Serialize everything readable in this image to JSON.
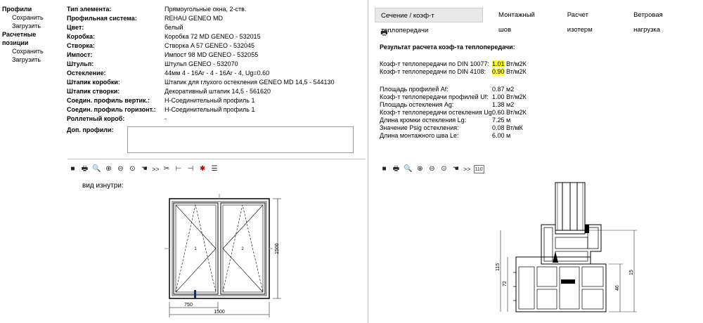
{
  "nav": {
    "profiles": "Профили",
    "profiles_save": "Сохранить",
    "profiles_load": "Загрузить",
    "positions": "Расчетные позиции",
    "positions_save": "Сохранить",
    "positions_load": "Загрузить"
  },
  "props": [
    {
      "label": "Тип элемента:",
      "value": "Прямоугольные окна, 2-ств."
    },
    {
      "label": "Профильная система:",
      "value": "REHAU GENEO MD"
    },
    {
      "label": "Цвет:",
      "value": "белый"
    },
    {
      "label": "Коробка:",
      "value": "Коробка 72 MD GENEO - 532015"
    },
    {
      "label": "Створка:",
      "value": "Створка A 57 GENEO - 532045"
    },
    {
      "label": "Импост:",
      "value": "Импост 98 MD GENEO - 532055"
    },
    {
      "label": "Штульп:",
      "value": "Штульп GENEO - 532070"
    },
    {
      "label": "Остекление:",
      "value": "44мм 4 - 16Ar - 4 - 16Ar - 4, Ug=0.60"
    },
    {
      "label": "Штапик коробки:",
      "value": "Штапик для глухого остекления GENEO MD 14,5 - 544130"
    },
    {
      "label": "Штапик створки:",
      "value": "Декоративный штапик 14,5 - 561620"
    },
    {
      "label": "Соедин. профиль вертик.:",
      "value": "Н-Соединительный профиль  1"
    },
    {
      "label": "Соедин. профиль горизонт.:",
      "value": "Н-Соединительный профиль  1"
    },
    {
      "label": "Роллетный короб:",
      "value": "-"
    }
  ],
  "extra_profiles_label": "Доп. профили:",
  "inside_view_label": "вид изнутри:",
  "toolbar_left": [
    {
      "name": "save-icon",
      "glyph": "■"
    },
    {
      "name": "print-icon",
      "glyph": "🖶"
    },
    {
      "name": "zoom-icon",
      "glyph": "🔍"
    },
    {
      "name": "zoom-in-icon",
      "glyph": "⊕"
    },
    {
      "name": "zoom-out-icon",
      "glyph": "⊖"
    },
    {
      "name": "zoom-fit-icon",
      "glyph": "⊙"
    },
    {
      "name": "pan-hand-icon",
      "glyph": "☚"
    },
    {
      "name": "next-icon",
      "glyph": ">>"
    },
    {
      "name": "cut-icon",
      "glyph": "✂"
    },
    {
      "name": "dimension-left-icon",
      "glyph": "⊢"
    },
    {
      "name": "dimension-right-icon",
      "glyph": "⊣"
    },
    {
      "name": "burst-icon",
      "glyph": "✱"
    },
    {
      "name": "list-icon",
      "glyph": "☰"
    }
  ],
  "toolbar_right": [
    {
      "name": "save-icon",
      "glyph": "■"
    },
    {
      "name": "print-icon",
      "glyph": "🖶"
    },
    {
      "name": "zoom-icon",
      "glyph": "🔍"
    },
    {
      "name": "zoom-in-icon",
      "glyph": "⊕"
    },
    {
      "name": "zoom-out-icon",
      "glyph": "⊖"
    },
    {
      "name": "zoom-fit-icon",
      "glyph": "⊙"
    },
    {
      "name": "pan-hand-icon",
      "glyph": "☚"
    },
    {
      "name": "next-icon",
      "glyph": ">>"
    },
    {
      "name": "scale-icon",
      "glyph": "110"
    }
  ],
  "tabs": [
    {
      "label": "Сечение / коэф-т теплопередачи",
      "active": true
    },
    {
      "label": "Монтажный шов",
      "active": false
    },
    {
      "label": "Расчет изотерм",
      "active": false
    },
    {
      "label": "Ветровая нагрузка",
      "active": false
    }
  ],
  "results": {
    "title": "Результат расчета коэф-та теплопередачи:",
    "din10077_label": "Коэф-т теплопередачи по DIN 10077:",
    "din10077_value": "1.01",
    "din4108_label": "Коэф-т теплопередачи по DIN 4108:",
    "din4108_value": "0.90",
    "unit": " Вт/м2К",
    "rows": [
      {
        "label": "Площадь профилей Af:",
        "value": "0.87 м2"
      },
      {
        "label": "Коэф-т теплопередачи профилей Uf:",
        "value": "1.00 Вт/м2К"
      },
      {
        "label": "Площадь остекления Ag:",
        "value": "1.38 м2"
      },
      {
        "label": "Коэф-т теплопередачи остекления Ug:",
        "value": "0.60 Вт/м2К"
      },
      {
        "label": "Длина кромки остекления Lg:",
        "value": "7.25 м"
      },
      {
        "label": "Значение Psig остекления:",
        "value": "0.08 Вт/мК"
      },
      {
        "label": "Длина монтажного шва Le:",
        "value": "6.00 м"
      }
    ]
  },
  "window_drawing": {
    "sash1": "1",
    "sash2": "2",
    "height_dim": "1500",
    "sash_width_dim": "750",
    "total_width_dim": "1500"
  },
  "section_drawing": {
    "dim_115": "115",
    "dim_72": "72",
    "dim_46": "46",
    "dim_15": "15"
  },
  "colors": {
    "highlight": "#ffff20",
    "active_tab": "#e8e8e8",
    "accent_red": "#c00000"
  }
}
